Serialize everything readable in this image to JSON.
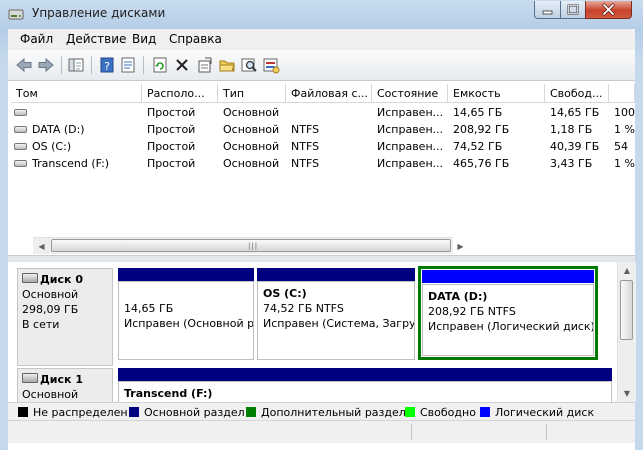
{
  "window": {
    "title": "Управление дисками",
    "accent": "#c9dcef",
    "close_color": "#c7432b"
  },
  "menu": {
    "items": [
      "Файл",
      "Действие",
      "Вид",
      "Справка"
    ]
  },
  "toolbar": {
    "buttons": [
      "back-arrow-icon",
      "forward-arrow-icon",
      "console-tree-icon",
      "help-icon",
      "properties-icon",
      "refresh-icon",
      "delete-icon",
      "settings-icon",
      "open-folder-icon",
      "search-icon",
      "disk-properties-icon"
    ]
  },
  "volume_list": {
    "columns": [
      "Том",
      "Располо...",
      "Тип",
      "Файловая с...",
      "Состояние",
      "Емкость",
      "Свобод...",
      "%"
    ],
    "rows": [
      {
        "name": "",
        "layout": "Простой",
        "type": "Основной",
        "fs": "",
        "status": "Исправен...",
        "capacity": "14,65 ГБ",
        "free": "14,65 ГБ",
        "pct": "100"
      },
      {
        "name": "DATA (D:)",
        "layout": "Простой",
        "type": "Основной",
        "fs": "NTFS",
        "status": "Исправен...",
        "capacity": "208,92 ГБ",
        "free": "1,18 ГБ",
        "pct": "1 %"
      },
      {
        "name": "OS (C:)",
        "layout": "Простой",
        "type": "Основной",
        "fs": "NTFS",
        "status": "Исправен...",
        "capacity": "74,52 ГБ",
        "free": "40,39 ГБ",
        "pct": "54"
      },
      {
        "name": "Transcend (F:)",
        "layout": "Простой",
        "type": "Основной",
        "fs": "NTFS",
        "status": "Исправен...",
        "capacity": "465,76 ГБ",
        "free": "3,43 ГБ",
        "pct": "1 %"
      }
    ]
  },
  "disks": [
    {
      "name": "Диск 0",
      "kind": "Основной",
      "size": "298,09 ГБ",
      "state": "В сети",
      "partitions": [
        {
          "name": "",
          "size": "14,65 ГБ",
          "status": "Исправен (Основной раздел)",
          "bar_color": "#000080",
          "selected": false
        },
        {
          "name": "OS  (C:)",
          "size": "74,52 ГБ NTFS",
          "status": "Исправен (Система, Загрузка, Файл подкачки)",
          "bar_color": "#000080",
          "selected": false
        },
        {
          "name": "DATA  (D:)",
          "size": "208,92 ГБ NTFS",
          "status": "Исправен (Логический диск)",
          "bar_color": "#0000ff",
          "selected": true
        }
      ]
    },
    {
      "name": "Диск 1",
      "kind": "Основной",
      "partitions": [
        {
          "name": "Transcend  (F:)",
          "bar_color": "#000080"
        }
      ]
    }
  ],
  "legend": [
    {
      "label": "Не распределен",
      "color": "#000000"
    },
    {
      "label": "Основной раздел",
      "color": "#000080"
    },
    {
      "label": "Дополнительный раздел",
      "color": "#008000"
    },
    {
      "label": "Свободно",
      "color": "#00ff00"
    },
    {
      "label": "Логический диск",
      "color": "#0000ff"
    }
  ]
}
